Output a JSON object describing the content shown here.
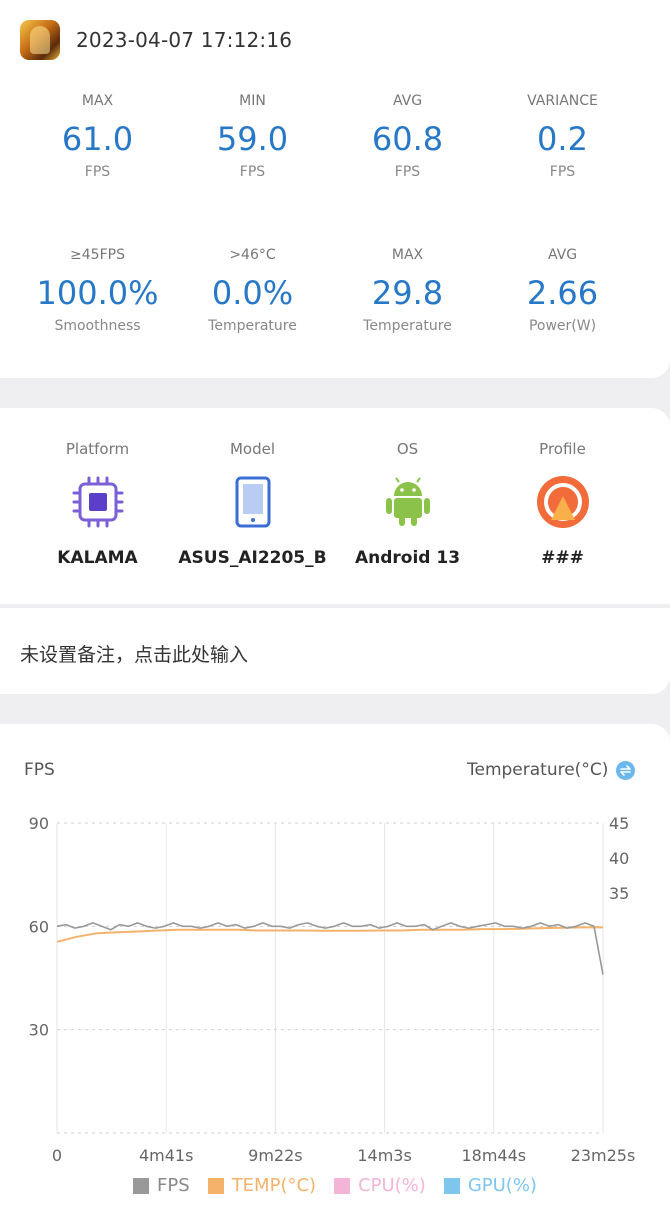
{
  "header": {
    "timestamp": "2023-04-07 17:12:16",
    "app_icon": "game-app-icon"
  },
  "stats_row1": [
    {
      "label": "MAX",
      "value": "61.0",
      "unit": "FPS"
    },
    {
      "label": "MIN",
      "value": "59.0",
      "unit": "FPS"
    },
    {
      "label": "AVG",
      "value": "60.8",
      "unit": "FPS"
    },
    {
      "label": "VARIANCE",
      "value": "0.2",
      "unit": "FPS"
    }
  ],
  "stats_row2": [
    {
      "label": "≥45FPS",
      "value": "100.0%",
      "unit": "Smoothness"
    },
    {
      "label": ">46°C",
      "value": "0.0%",
      "unit": "Temperature"
    },
    {
      "label": "MAX",
      "value": "29.8",
      "unit": "Temperature"
    },
    {
      "label": "AVG",
      "value": "2.66",
      "unit": "Power(W)"
    }
  ],
  "device": [
    {
      "label": "Platform",
      "value": "KALAMA",
      "icon": "chip-icon"
    },
    {
      "label": "Model",
      "value": "ASUS_AI2205_B",
      "icon": "phone-icon"
    },
    {
      "label": "OS",
      "value": "Android 13",
      "icon": "android-icon"
    },
    {
      "label": "Profile",
      "value": "###",
      "icon": "profile-icon"
    }
  ],
  "note": {
    "placeholder": "未设置备注，点击此处输入"
  },
  "colors": {
    "accent": "#2878c8",
    "fps": "#999999",
    "temp": "#f5b26b",
    "cpu": "#f4b4d8",
    "gpu": "#7ec6ee"
  },
  "chart_data": {
    "type": "line",
    "left_axis_title": "FPS",
    "right_axis_title": "Temperature(°C)",
    "left_ticks": [
      "90",
      "60",
      "30"
    ],
    "left_ylim": [
      0,
      90
    ],
    "right_ticks": [
      "45",
      "40",
      "35"
    ],
    "x_ticks": [
      "0",
      "4m41s",
      "9m22s",
      "14m3s",
      "18m44s",
      "23m25s"
    ],
    "grid": true,
    "legend_position": "bottom",
    "legend": [
      "FPS",
      "TEMP(°C)",
      "CPU(%)",
      "GPU(%)"
    ],
    "series": [
      {
        "name": "FPS",
        "values": [
          60,
          60.5,
          59.5,
          60,
          61,
          60,
          59,
          60.5,
          60,
          61,
          60,
          59.5,
          60,
          61,
          60,
          60,
          59.5,
          60,
          61,
          60,
          60.5,
          59.5,
          60,
          61,
          60,
          60,
          59.5,
          60.5,
          61,
          60,
          59.5,
          60,
          61,
          60,
          60,
          60.5,
          59.5,
          60,
          61,
          60,
          60,
          60.5,
          59,
          60,
          61,
          60,
          59.5,
          60,
          60.5,
          61,
          60,
          60,
          59.5,
          60,
          61,
          60,
          60.5,
          59.5,
          60,
          61,
          60,
          46
        ]
      },
      {
        "name": "TEMP(°C)",
        "values": [
          55.5,
          57,
          58,
          58.3,
          58.5,
          58.8,
          59,
          59,
          59,
          59,
          58.8,
          58.8,
          58.8,
          58.7,
          58.7,
          58.7,
          58.8,
          58.8,
          59,
          59,
          59,
          59.2,
          59.2,
          59.3,
          59.5,
          59.6,
          59.7,
          59.7
        ]
      }
    ]
  }
}
